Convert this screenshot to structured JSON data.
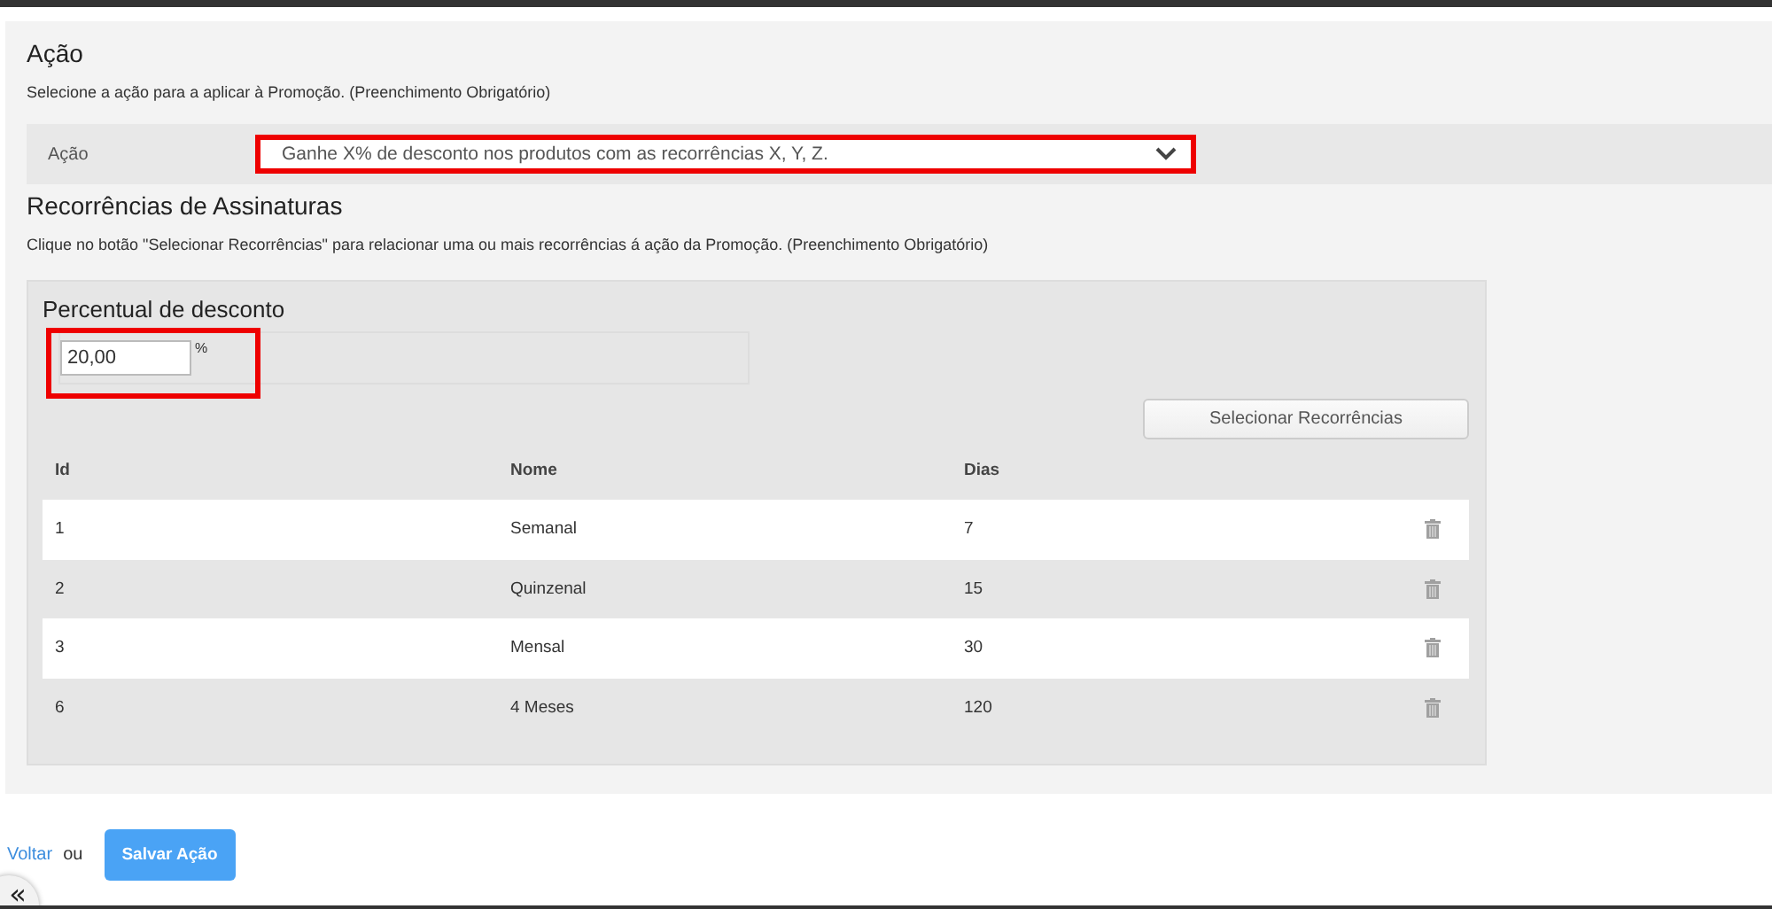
{
  "acao_section": {
    "title": "Ação",
    "description": "Selecione a ação para a aplicar à Promoção. (Preenchimento Obrigatório)",
    "field_label": "Ação",
    "select_value": "Ganhe X% de desconto nos produtos com as recorrências X, Y, Z.",
    "highlighted": true
  },
  "recorrencias_section": {
    "title": "Recorrências de Assinaturas",
    "description": "Clique no botão \"Selecionar Recorrências\" para relacionar uma ou mais recorrências á ação da Promoção. (Preenchimento Obrigatório)",
    "discount": {
      "title": "Percentual de desconto",
      "value": "20,00",
      "unit": "%",
      "highlighted": true
    },
    "select_button": "Selecionar Recorrências",
    "table": {
      "columns": [
        "Id",
        "Nome",
        "Dias"
      ],
      "rows": [
        {
          "id": "1",
          "nome": "Semanal",
          "dias": "7"
        },
        {
          "id": "2",
          "nome": "Quinzenal",
          "dias": "15"
        },
        {
          "id": "3",
          "nome": "Mensal",
          "dias": "30"
        },
        {
          "id": "6",
          "nome": "4 Meses",
          "dias": "120"
        }
      ]
    }
  },
  "footer": {
    "back_link": "Voltar",
    "separator": "ou",
    "save_button": "Salvar Ação",
    "collapse_button": "«"
  }
}
